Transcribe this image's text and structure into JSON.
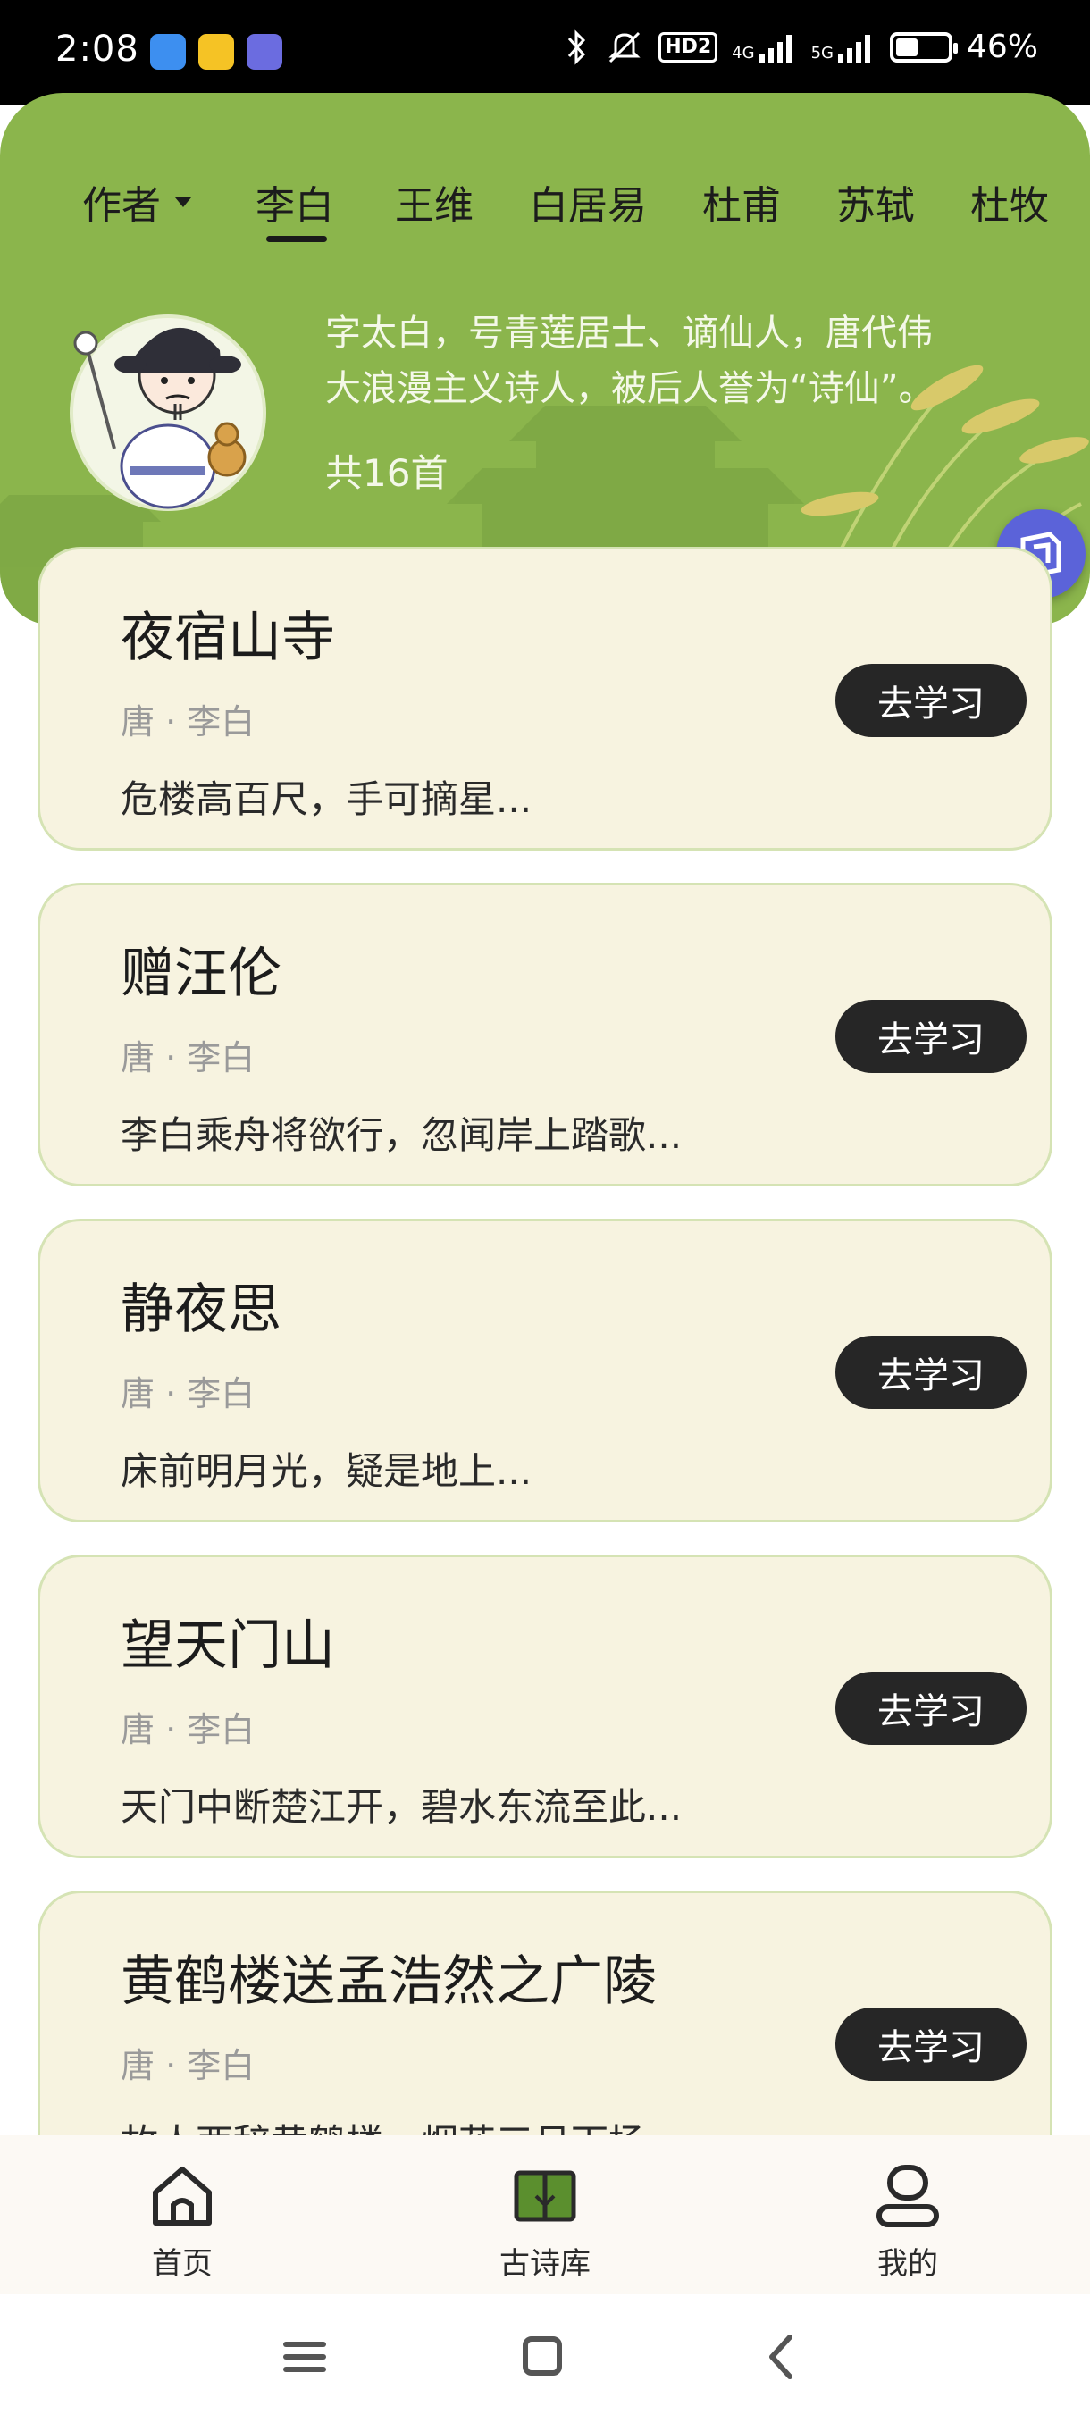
{
  "status_bar": {
    "time": "2:08",
    "hd_label": "HD2",
    "net_4g": "4G",
    "net_5g": "5G",
    "battery_percent": "46%",
    "battery_level": 0.46
  },
  "header": {
    "tabs": [
      {
        "label": "作者"
      },
      {
        "label": "李白"
      },
      {
        "label": "王维"
      },
      {
        "label": "白居易"
      },
      {
        "label": "杜甫"
      },
      {
        "label": "苏轼"
      },
      {
        "label": "杜牧"
      }
    ],
    "selected_tab": "李白",
    "intro_line1": "字太白，号青莲居士、谪仙人，唐代伟",
    "intro_line2": "大浪漫主义诗人，被后人誉为“诗仙”。",
    "count": "共16首"
  },
  "poems": [
    {
      "title": "夜宿山寺",
      "meta": "唐 · 李白",
      "excerpt": "危楼高百尺，手可摘星...",
      "button": "去学习"
    },
    {
      "title": "赠汪伦",
      "meta": "唐 · 李白",
      "excerpt": "李白乘舟将欲行，忽闻岸上踏歌...",
      "button": "去学习"
    },
    {
      "title": "静夜思",
      "meta": "唐 · 李白",
      "excerpt": "床前明月光，疑是地上...",
      "button": "去学习"
    },
    {
      "title": "望天门山",
      "meta": "唐 · 李白",
      "excerpt": "天门中断楚江开，碧水东流至此...",
      "button": "去学习"
    },
    {
      "title": "黄鹤楼送孟浩然之广陵",
      "meta": "唐 · 李白",
      "excerpt": "故人西辞黄鹤楼，烟花三月下扬...",
      "button": "去学习"
    }
  ],
  "bottom_nav": {
    "home": "首页",
    "library": "古诗库",
    "mine": "我的"
  },
  "colors": {
    "header_green": "#8bb54c",
    "card_bg": "#f7f3e0",
    "button_dark": "#262626",
    "library_icon_green": "#5b8f2e",
    "floating_badge": "#5b63d9"
  },
  "icons": [
    "home-icon",
    "book-icon",
    "profile-icon",
    "menu-icon",
    "square-icon",
    "back-icon",
    "bluetooth-icon",
    "mute-icon",
    "signal-icon",
    "battery-icon"
  ]
}
